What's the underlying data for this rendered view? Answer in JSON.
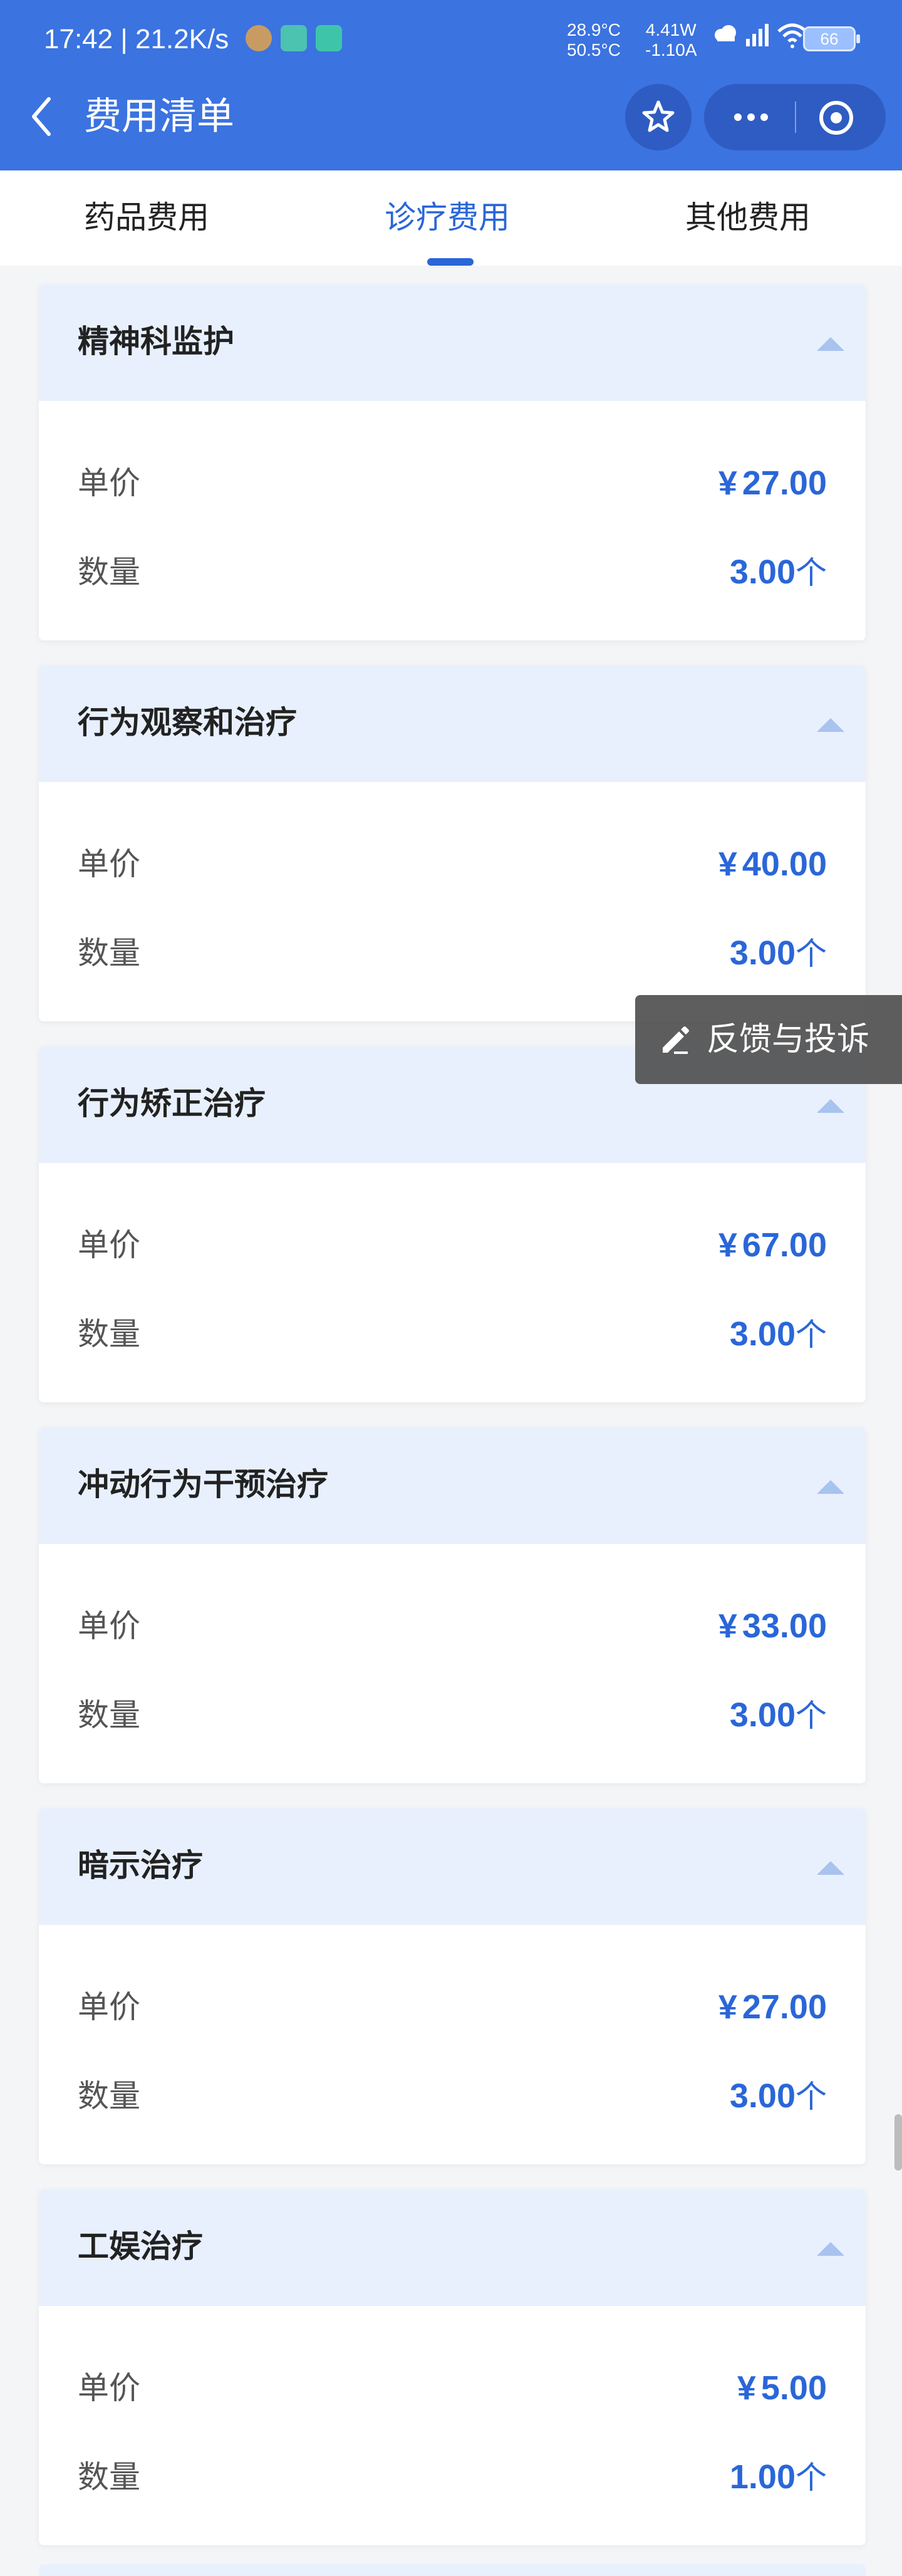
{
  "status_bar": {
    "time": "17:42 | 21.2K/s",
    "temp_top": "28.9°C",
    "temp_bottom": "50.5°C",
    "power_top": "4.41W",
    "power_bottom": "-1.10A",
    "battery": "66"
  },
  "header": {
    "title": "费用清单"
  },
  "tabs": [
    {
      "label": "药品费用"
    },
    {
      "label": "诊疗费用"
    },
    {
      "label": "其他费用"
    }
  ],
  "active_tab": 1,
  "items": [
    {
      "name": "精神科监护",
      "price_label": "单价",
      "price_currency": "¥",
      "price": "27.00",
      "qty_label": "数量",
      "qty": "3.00",
      "qty_unit": "个"
    },
    {
      "name": "行为观察和治疗",
      "price_label": "单价",
      "price_currency": "¥",
      "price": "40.00",
      "qty_label": "数量",
      "qty": "3.00",
      "qty_unit": "个"
    },
    {
      "name": "行为矫正治疗",
      "price_label": "单价",
      "price_currency": "¥",
      "price": "67.00",
      "qty_label": "数量",
      "qty": "3.00",
      "qty_unit": "个"
    },
    {
      "name": "冲动行为干预治疗",
      "price_label": "单价",
      "price_currency": "¥",
      "price": "33.00",
      "qty_label": "数量",
      "qty": "3.00",
      "qty_unit": "个"
    },
    {
      "name": "暗示治疗",
      "price_label": "单价",
      "price_currency": "¥",
      "price": "27.00",
      "qty_label": "数量",
      "qty": "3.00",
      "qty_unit": "个"
    },
    {
      "name": "工娱治疗",
      "price_label": "单价",
      "price_currency": "¥",
      "price": "5.00",
      "qty_label": "数量",
      "qty": "1.00",
      "qty_unit": "个"
    }
  ],
  "feedback": {
    "label": "反馈与投诉"
  },
  "colors": {
    "header_bg": "#3b73e0",
    "accent": "#2a66d8",
    "card_header_bg": "#e8f0fe"
  },
  "icons": [
    "back-arrow-icon",
    "star-icon",
    "more-icon",
    "record-icon",
    "chevron-up-icon",
    "edit-icon"
  ]
}
